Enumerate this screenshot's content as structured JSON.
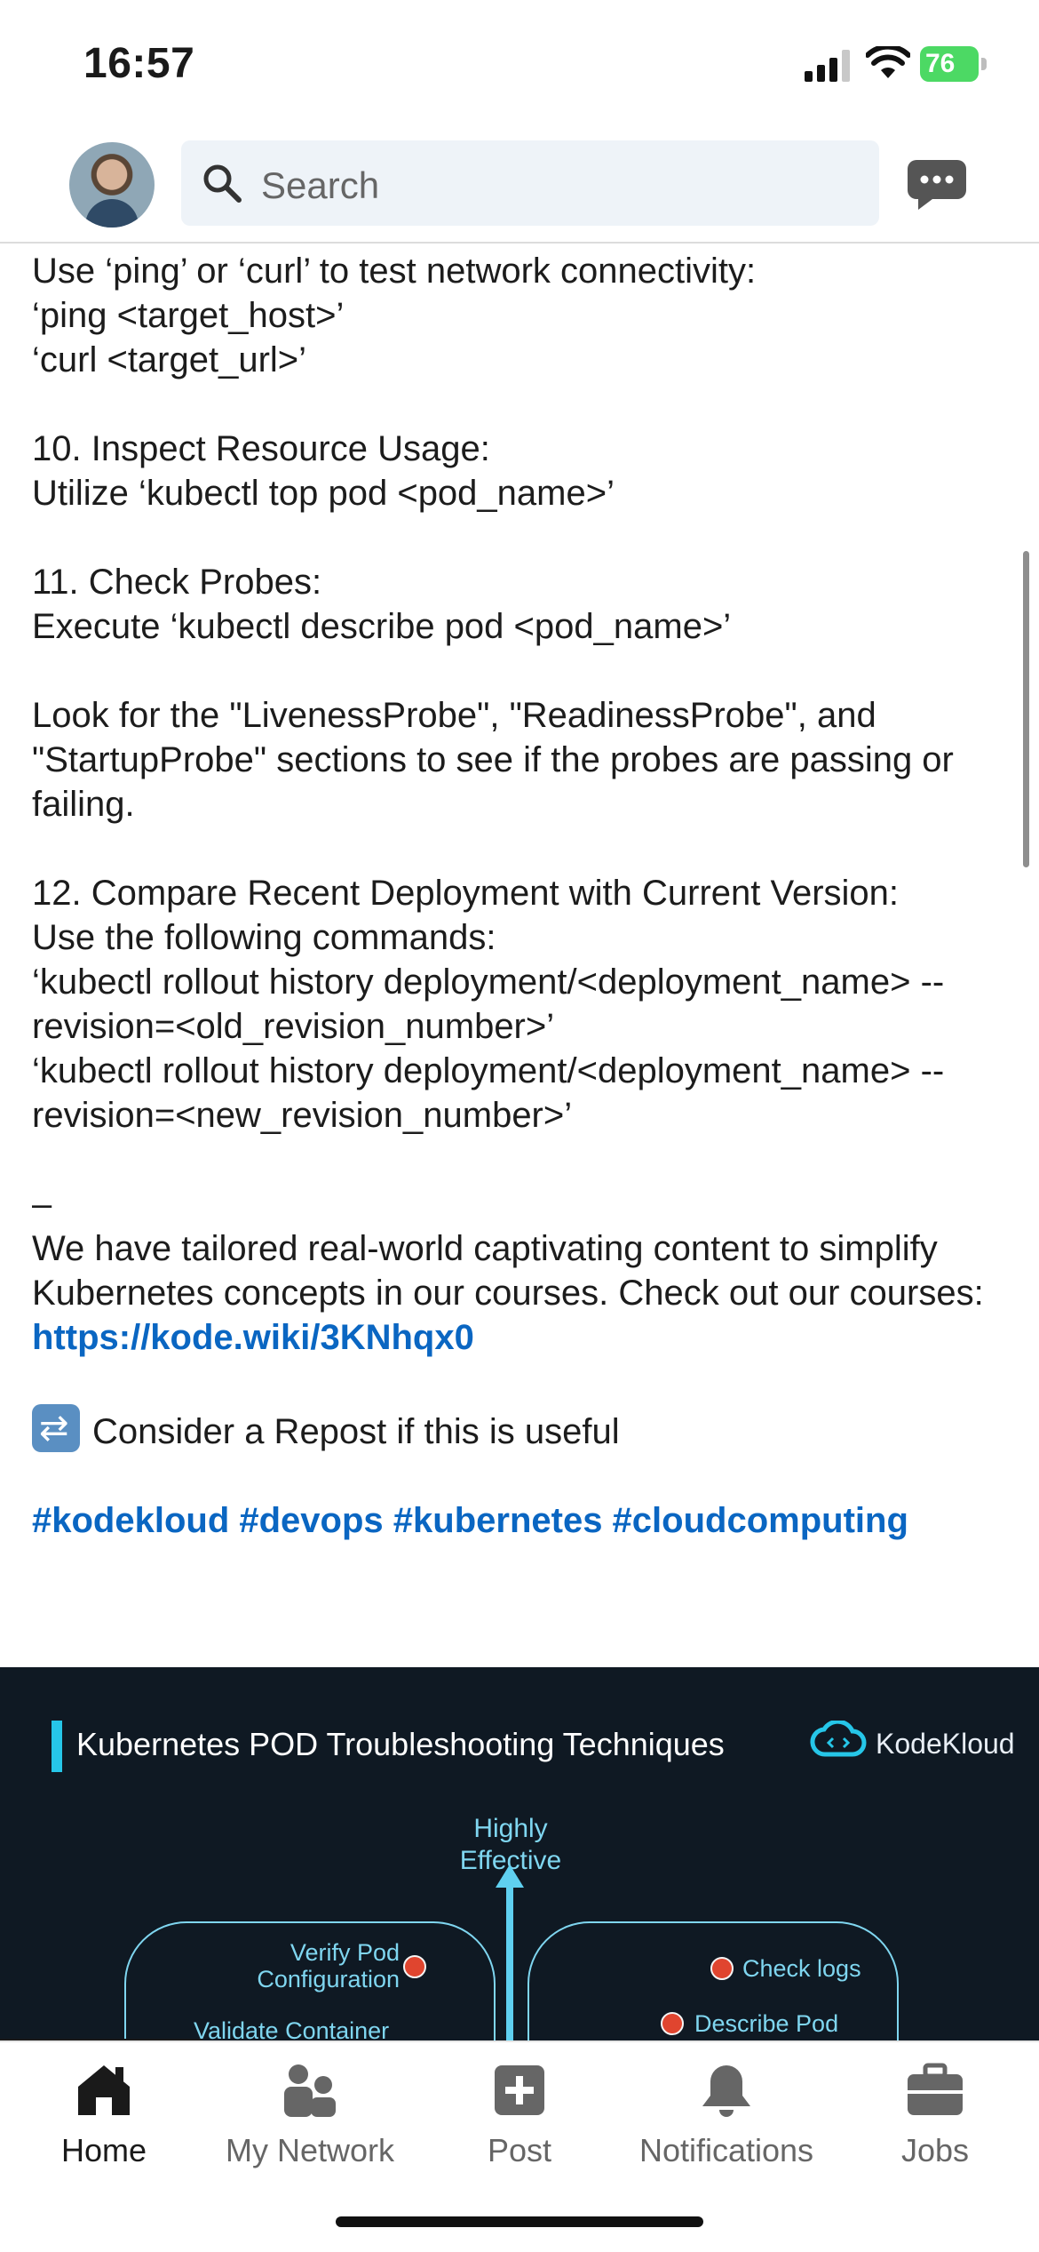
{
  "status_bar": {
    "time": "16:57",
    "battery_level": "76"
  },
  "top_bar": {
    "search_placeholder": "Search"
  },
  "post": {
    "lines_block1": "Use ‘ping’ or ‘curl’ to test network connectivity:\n‘ping <target_host>’\n‘curl <target_url>’",
    "step10_title": "10. Inspect Resource Usage:",
    "step10_body": "Utilize ‘kubectl top pod <pod_name>’",
    "step11_title": "11. Check Probes:",
    "step11_body": "Execute ‘kubectl describe pod <pod_name>’",
    "probes_note": "Look for the \"LivenessProbe\", \"ReadinessProbe\", and \"StartupProbe\" sections to see if the probes are passing or failing.",
    "step12_title": "12. Compare Recent Deployment with Current Version:",
    "step12_body": "Use the following commands:\n‘kubectl rollout history deployment/<deployment_name> --revision=<old_revision_number>’\n‘kubectl rollout history deployment/<deployment_name> --revision=<new_revision_number>’",
    "separator": "–",
    "courses_text": "We have tailored real-world captivating content to simplify Kubernetes concepts in our courses. Check out our courses: ",
    "courses_link": "https://kode.wiki/3KNhqx0",
    "repost_text": "Consider a Repost if this is useful",
    "hashtags": "#kodekloud #devops #kubernetes #cloudcomputing"
  },
  "image_card": {
    "title": "Kubernetes POD Troubleshooting Techniques",
    "brand": "KodeKloud",
    "axis_label": "Highly Effective",
    "left_items": [
      "Verify Pod Configuration",
      "Validate Container"
    ],
    "right_items": [
      "Check logs",
      "Describe Pod"
    ],
    "accent_color": "#26c6e8"
  },
  "bottom_nav": {
    "items": [
      {
        "label": "Home",
        "icon": "home-icon"
      },
      {
        "label": "My Network",
        "icon": "network-icon"
      },
      {
        "label": "Post",
        "icon": "post-icon"
      },
      {
        "label": "Notifications",
        "icon": "bell-icon"
      },
      {
        "label": "Jobs",
        "icon": "briefcase-icon"
      }
    ]
  }
}
